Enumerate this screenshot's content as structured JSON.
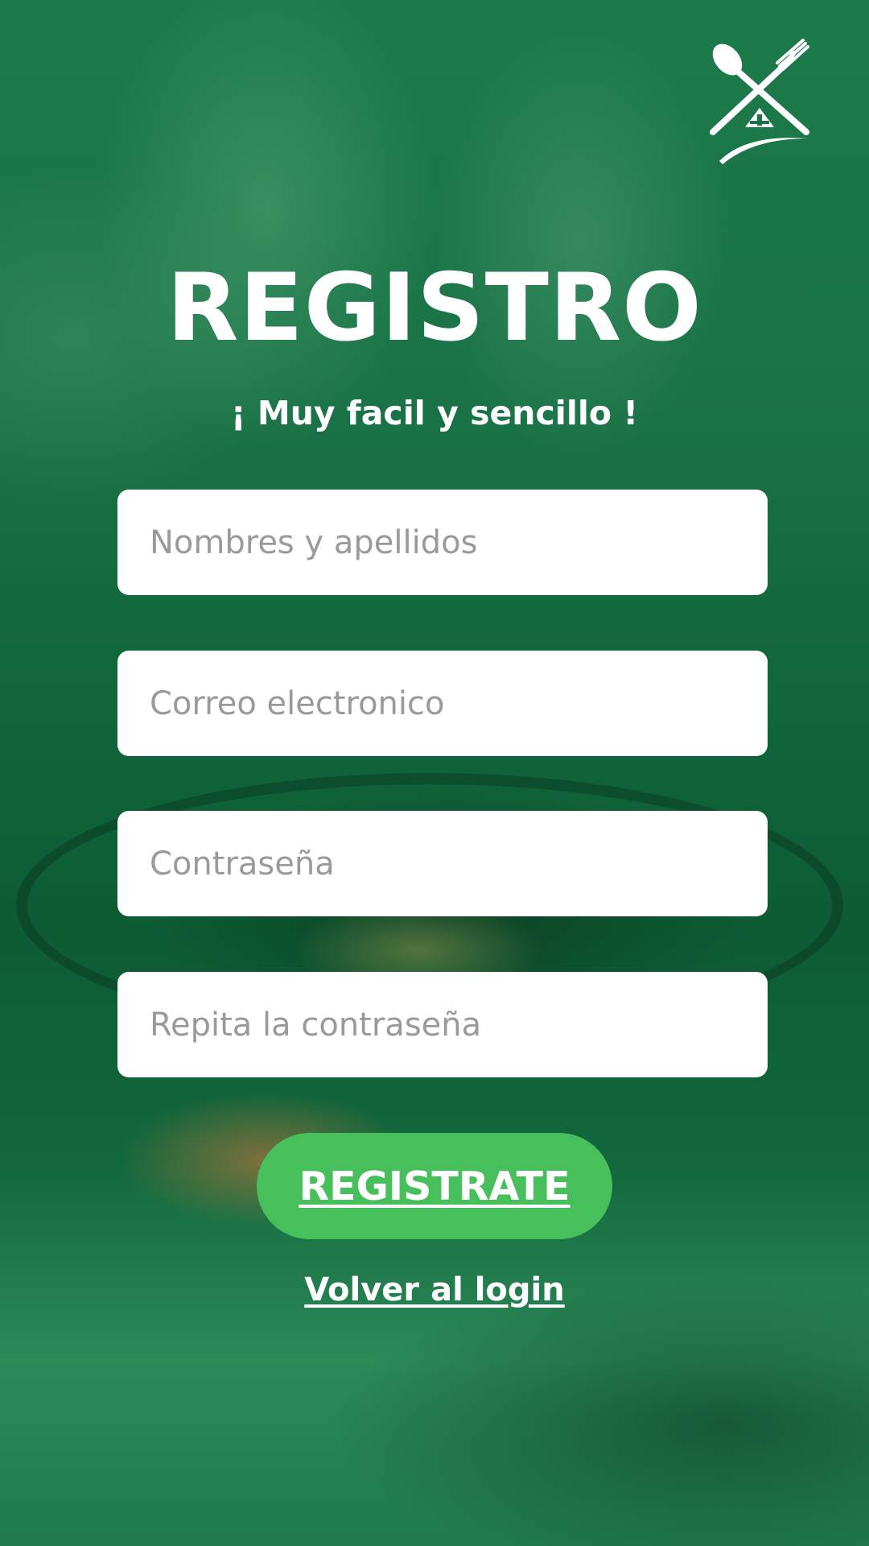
{
  "screen": {
    "title": "REGISTRO",
    "subtitle": "¡ Muy facil y sencillo !"
  },
  "logo": {
    "icon": "spoon-fork-house-logo"
  },
  "form": {
    "name_placeholder": "Nombres y apellidos",
    "email_placeholder": "Correo electronico",
    "password_placeholder": "Contraseña",
    "repeat_password_placeholder": "Repita la contraseña",
    "submit_label": "REGISTRATE"
  },
  "links": {
    "back_to_login": "Volver al login"
  },
  "colors": {
    "overlay_green": "#1a7347",
    "button_green": "#47c05c",
    "field_bg": "#ffffff",
    "placeholder": "#9a9a9a"
  }
}
